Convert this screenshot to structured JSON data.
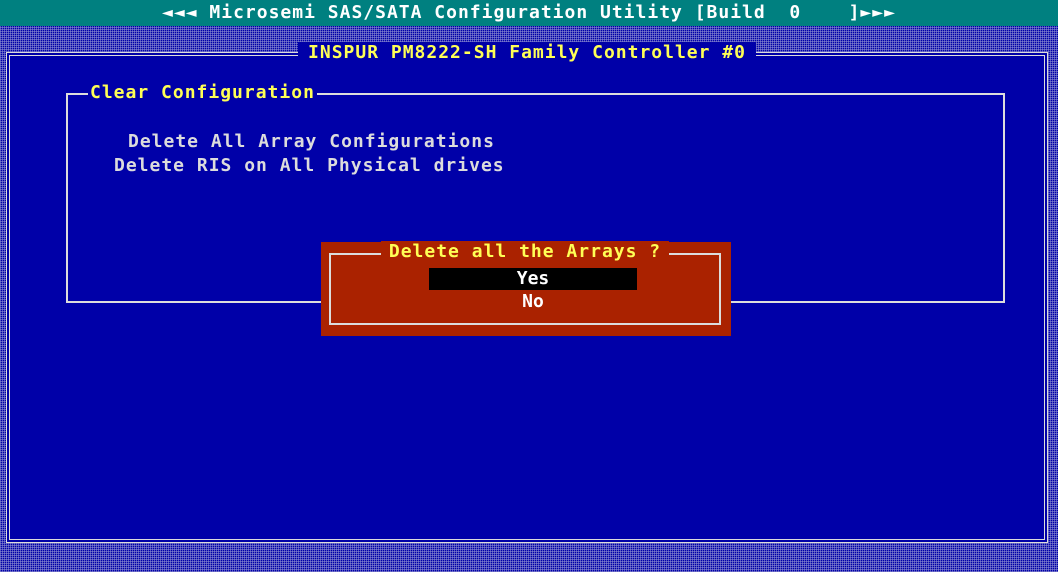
{
  "titlebar": {
    "text": "◄◄◄ Microsemi SAS/SATA Configuration Utility [Build  0    ]►►►"
  },
  "window": {
    "title": "INSPUR PM8222-SH Family Controller #0"
  },
  "panel": {
    "title": "Clear Configuration",
    "items": [
      {
        "label": "Delete All Array Configurations"
      },
      {
        "label": "Delete RIS on All Physical drives"
      }
    ]
  },
  "dialog": {
    "title": "Delete all the Arrays ?",
    "options": [
      {
        "label": "Yes",
        "selected": true
      },
      {
        "label": "No",
        "selected": false
      }
    ]
  },
  "colors": {
    "background": "#0000a8",
    "titlebar": "#008080",
    "dialog": "#aa2200",
    "highlight": "#ffff55",
    "text": "#dcdcdc"
  }
}
